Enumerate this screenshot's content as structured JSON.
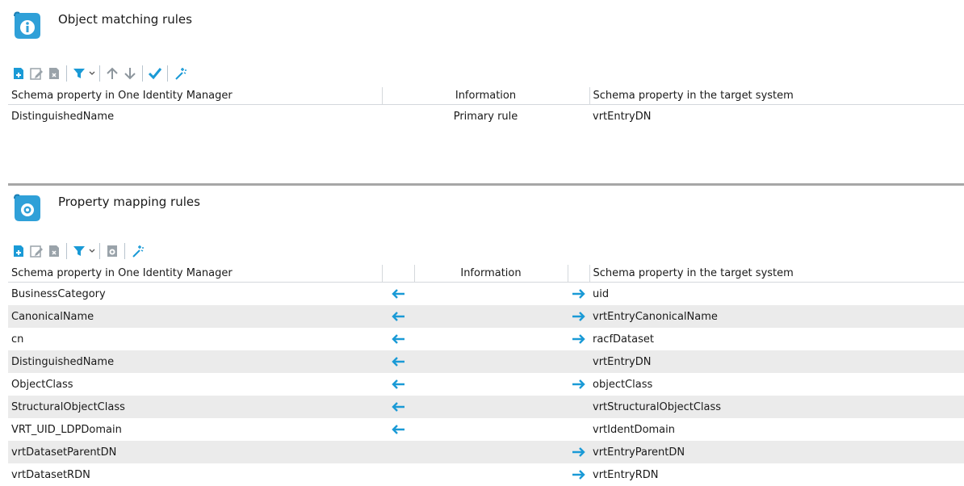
{
  "object_matching": {
    "title": "Object matching rules",
    "columns": {
      "left": "Schema property in One Identity Manager",
      "info": "Information",
      "right": "Schema property in the target system"
    },
    "rows": [
      {
        "left": "DistinguishedName",
        "info": "Primary rule",
        "right": "vrtEntryDN"
      }
    ]
  },
  "property_mapping": {
    "title": "Property mapping rules",
    "columns": {
      "left": "Schema property in One Identity Manager",
      "info": "Information",
      "right": "Schema property in the target system"
    },
    "rows": [
      {
        "left": "BusinessCategory",
        "left_arrow": true,
        "right_arrow": true,
        "right": "uid"
      },
      {
        "left": "CanonicalName",
        "left_arrow": true,
        "right_arrow": true,
        "right": "vrtEntryCanonicalName"
      },
      {
        "left": "cn",
        "left_arrow": true,
        "right_arrow": true,
        "right": "racfDataset"
      },
      {
        "left": "DistinguishedName",
        "left_arrow": true,
        "right_arrow": false,
        "right": "vrtEntryDN"
      },
      {
        "left": "ObjectClass",
        "left_arrow": true,
        "right_arrow": true,
        "right": "objectClass"
      },
      {
        "left": "StructuralObjectClass",
        "left_arrow": true,
        "right_arrow": false,
        "right": "vrtStructuralObjectClass"
      },
      {
        "left": "VRT_UID_LDPDomain",
        "left_arrow": true,
        "right_arrow": false,
        "right": "vrtIdentDomain"
      },
      {
        "left": "vrtDatasetParentDN",
        "left_arrow": false,
        "right_arrow": true,
        "right": "vrtEntryParentDN"
      },
      {
        "left": "vrtDatasetRDN",
        "left_arrow": false,
        "right_arrow": true,
        "right": "vrtEntryRDN"
      }
    ]
  },
  "icons": {
    "section1": "info-scroll-icon",
    "section2": "gear-scroll-icon",
    "toolbar1": [
      "new-icon",
      "edit-icon",
      "delete-icon",
      "filter-icon",
      "move-up-icon",
      "move-down-icon",
      "commit-icon",
      "wizard-icon"
    ],
    "toolbar2": [
      "new-icon",
      "edit-icon",
      "delete-icon",
      "filter-icon",
      "mapping-icon",
      "wizard-icon"
    ]
  },
  "colors": {
    "accent": "#1a9ad6",
    "arrow": "#1a9ad6",
    "row_alt": "#ebebeb",
    "divider": "#a7a7a7"
  }
}
